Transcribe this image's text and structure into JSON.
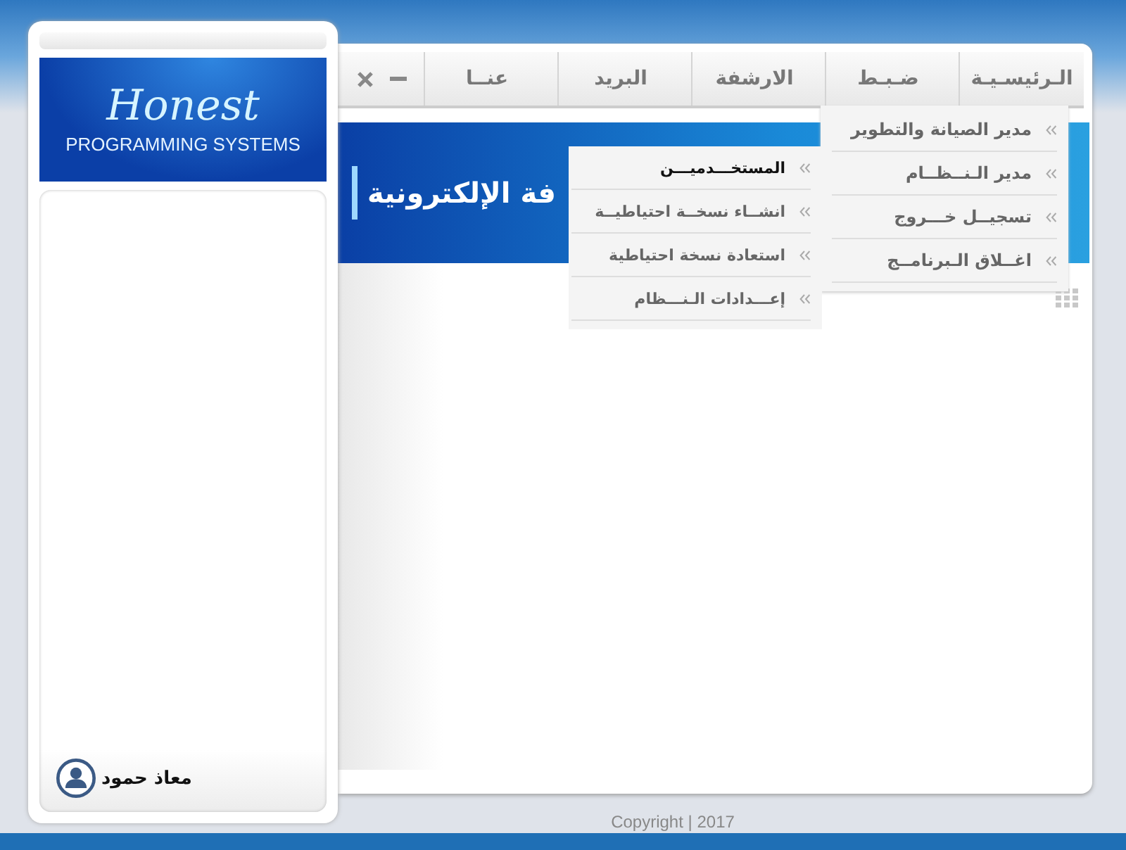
{
  "brand": {
    "script_title": "Honest",
    "subtitle": "PROGRAMMING SYSTEMS"
  },
  "user": {
    "name": "معاذ حمود"
  },
  "nav": {
    "items": [
      {
        "label": "الـرئيسـيـة"
      },
      {
        "label": "ضـبـط"
      },
      {
        "label": "الارشفة"
      },
      {
        "label": "البريد"
      },
      {
        "label": "عنــا"
      }
    ],
    "window_controls": [
      {
        "kind": "close"
      },
      {
        "kind": "minimize"
      }
    ]
  },
  "banner": {
    "title": "فة الإلكترونية"
  },
  "dropdown": {
    "items": [
      {
        "label": "مدير الصيانة والتطوير"
      },
      {
        "label": "مدير الـنــظــام"
      },
      {
        "label": "تسجيــل خـــروج"
      },
      {
        "label": "اغــلاق الـبرنامــج"
      }
    ]
  },
  "submenu": {
    "items": [
      {
        "label": "المستخـــدميـــن",
        "selected": true
      },
      {
        "label": "انشــاء نسخــة احتياطيــة",
        "selected": false
      },
      {
        "label": "استعادة نسخة احتياطية",
        "selected": false
      },
      {
        "label": "إعـــدادات الـنـــظام",
        "selected": false
      }
    ]
  },
  "footer": {
    "copyright": "Copyright | 2017"
  }
}
